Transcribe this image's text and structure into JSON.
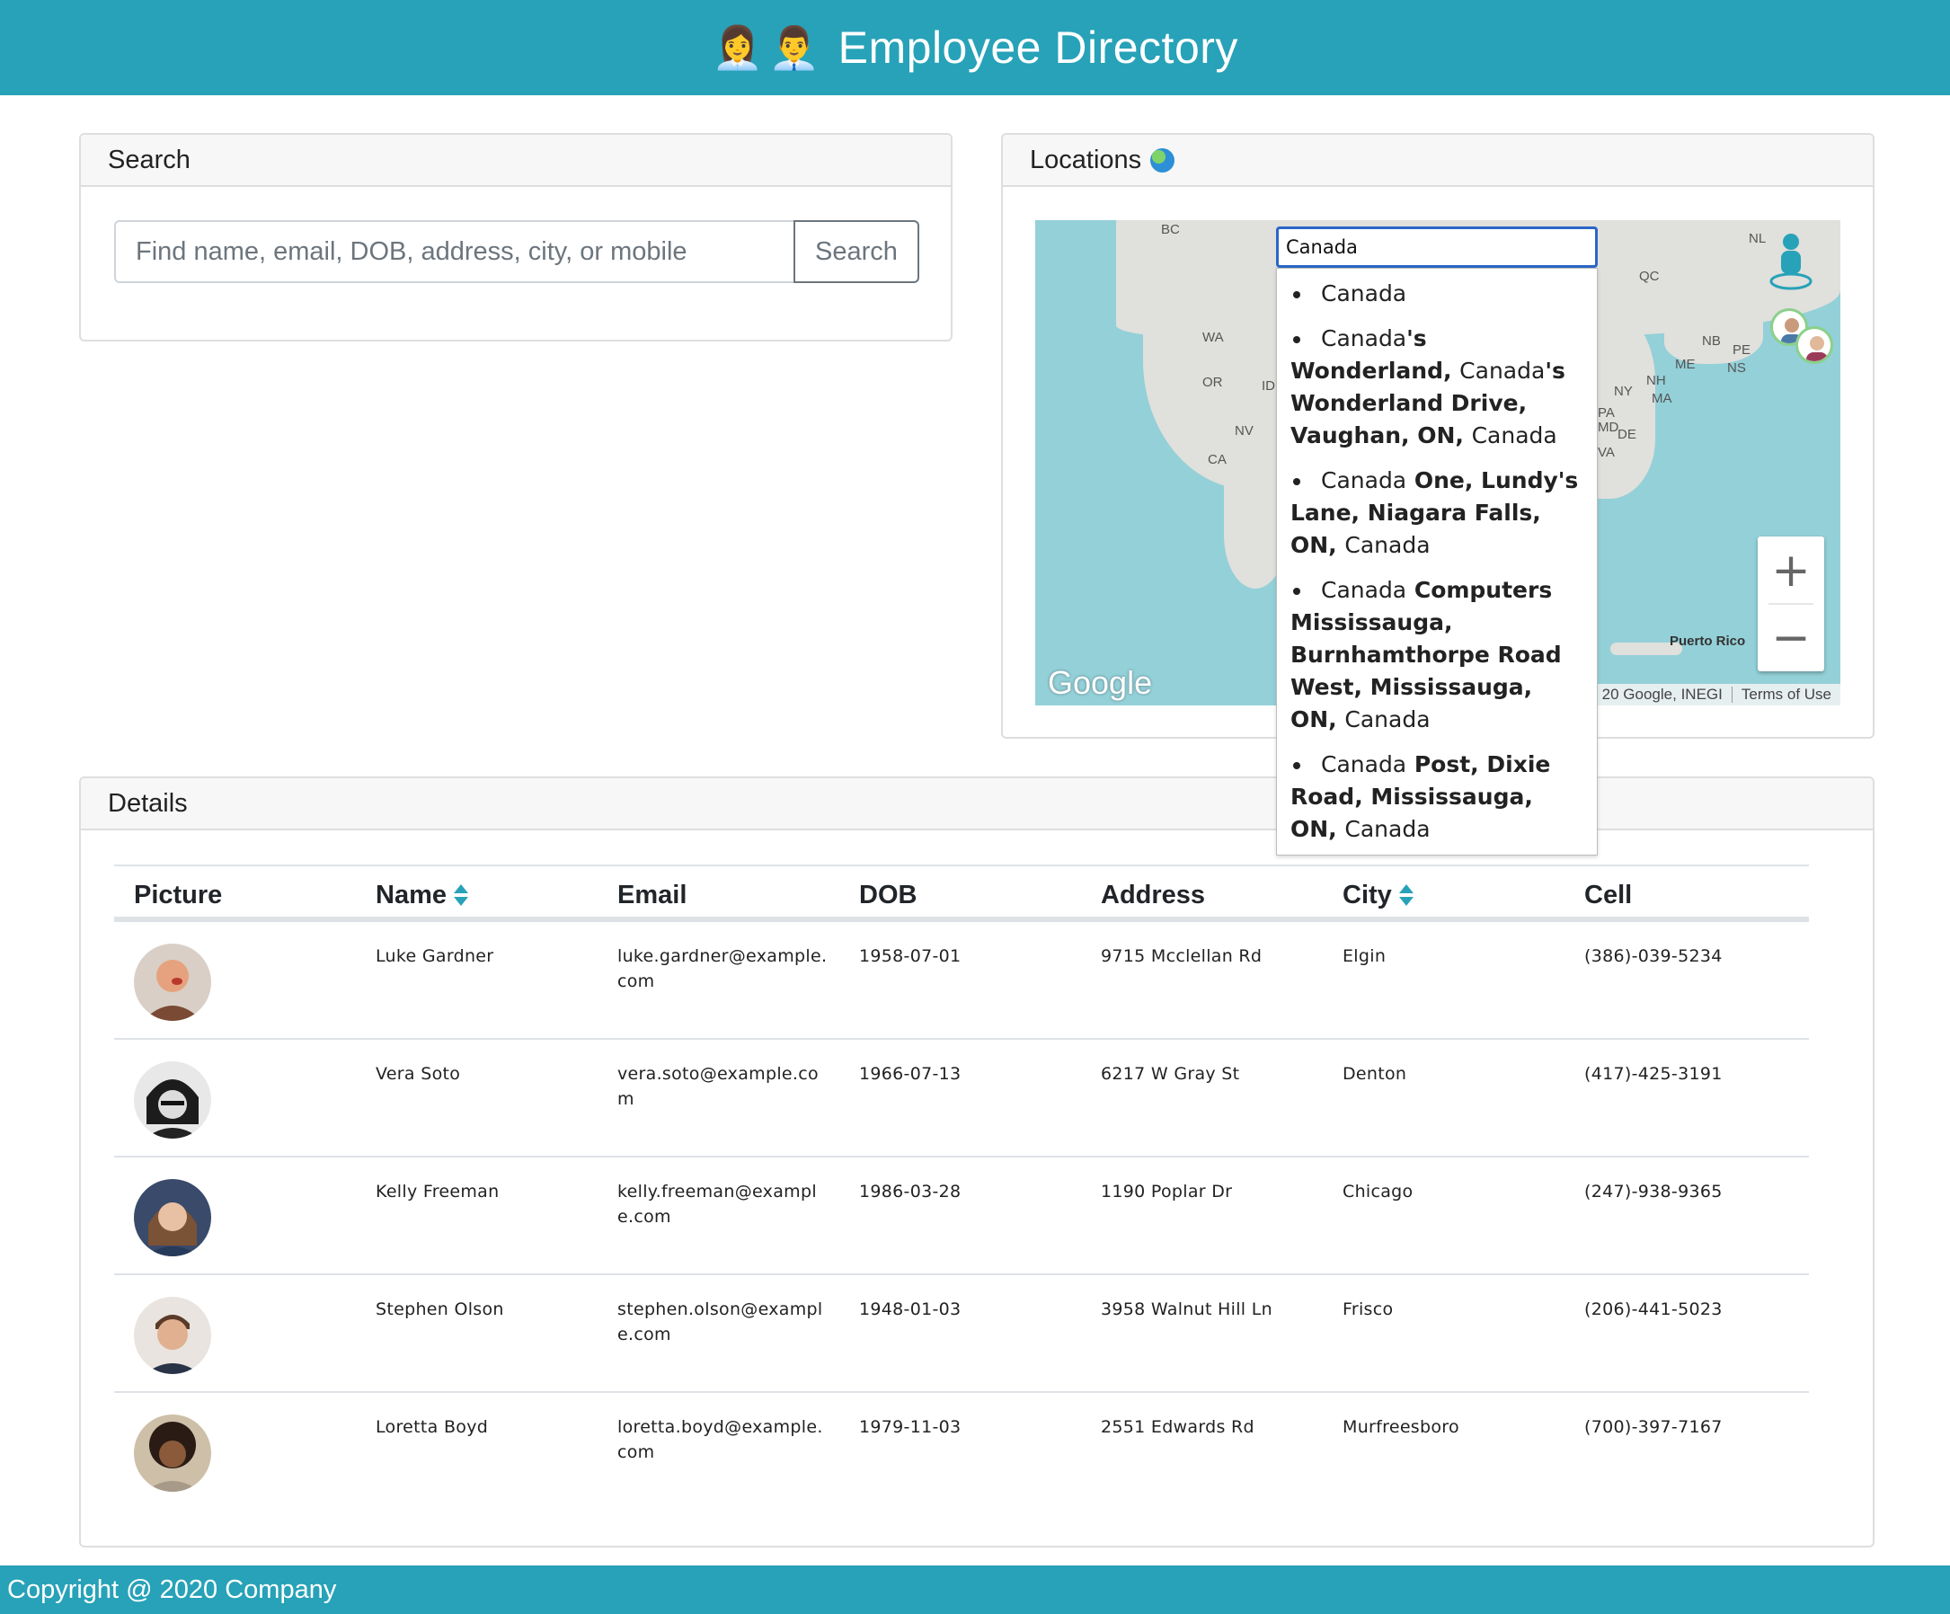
{
  "header": {
    "emoji": "👩‍💼👨‍💼",
    "title": "Employee Directory"
  },
  "search": {
    "heading": "Search",
    "placeholder": "Find name, email, DOB, address, city, or mobile",
    "button_label": "Search"
  },
  "locations": {
    "heading": "Locations",
    "map": {
      "labels": [
        "BC",
        "WA",
        "OR",
        "ID",
        "NV",
        "CA",
        "NL",
        "QC",
        "NB",
        "PE",
        "NS",
        "ME",
        "NH",
        "MA",
        "NY",
        "PA",
        "MD",
        "DE",
        "VA",
        "Puerto Rico"
      ],
      "attribution": "20 Google, INEGI",
      "terms": "Terms of Use",
      "logo": "Google",
      "zoom_in": "+",
      "zoom_out": "−"
    },
    "autocomplete": {
      "value": "Canada",
      "suggestions": [
        {
          "match": "Canada",
          "rest": "",
          "suffix": ""
        },
        {
          "match": "Canada",
          "rest": "'s Wonderland, ",
          "mid": "Canada",
          "rest2": "'s Wonderland Drive, Vaughan, ON, ",
          "suffix": "Canada"
        },
        {
          "match": "Canada",
          "rest": " One, Lundy's Lane, Niagara Falls, ON, ",
          "suffix": "Canada"
        },
        {
          "match": "Canada",
          "rest": " Computers Mississauga, Burnhamthorpe Road West, Mississauga, ON, ",
          "suffix": "Canada"
        },
        {
          "match": "Canada",
          "rest": " Post, Dixie Road, Mississauga, ON, ",
          "suffix": "Canada"
        }
      ]
    }
  },
  "details": {
    "heading": "Details",
    "columns": [
      "Picture",
      "Name",
      "Email",
      "DOB",
      "Address",
      "City",
      "Cell"
    ],
    "rows": [
      {
        "name": "Luke Gardner",
        "email": "luke.gardner@example.com",
        "dob": "1958-07-01",
        "address": "9715 Mcclellan Rd",
        "city": "Elgin",
        "cell": "(386)-039-5234"
      },
      {
        "name": "Vera Soto",
        "email": "vera.soto@example.com",
        "dob": "1966-07-13",
        "address": "6217 W Gray St",
        "city": "Denton",
        "cell": "(417)-425-3191"
      },
      {
        "name": "Kelly Freeman",
        "email": "kelly.freeman@example.com",
        "dob": "1986-03-28",
        "address": "1190 Poplar Dr",
        "city": "Chicago",
        "cell": "(247)-938-9365"
      },
      {
        "name": "Stephen Olson",
        "email": "stephen.olson@example.com",
        "dob": "1948-01-03",
        "address": "3958 Walnut Hill Ln",
        "city": "Frisco",
        "cell": "(206)-441-5023"
      },
      {
        "name": "Loretta Boyd",
        "email": "loretta.boyd@example.com",
        "dob": "1979-11-03",
        "address": "2551 Edwards Rd",
        "city": "Murfreesboro",
        "cell": "(700)-397-7167"
      }
    ]
  },
  "footer": {
    "text": "Copyright @ 2020 Company"
  },
  "colors": {
    "brand": "#27a2b8",
    "focus": "#2a66c6"
  }
}
